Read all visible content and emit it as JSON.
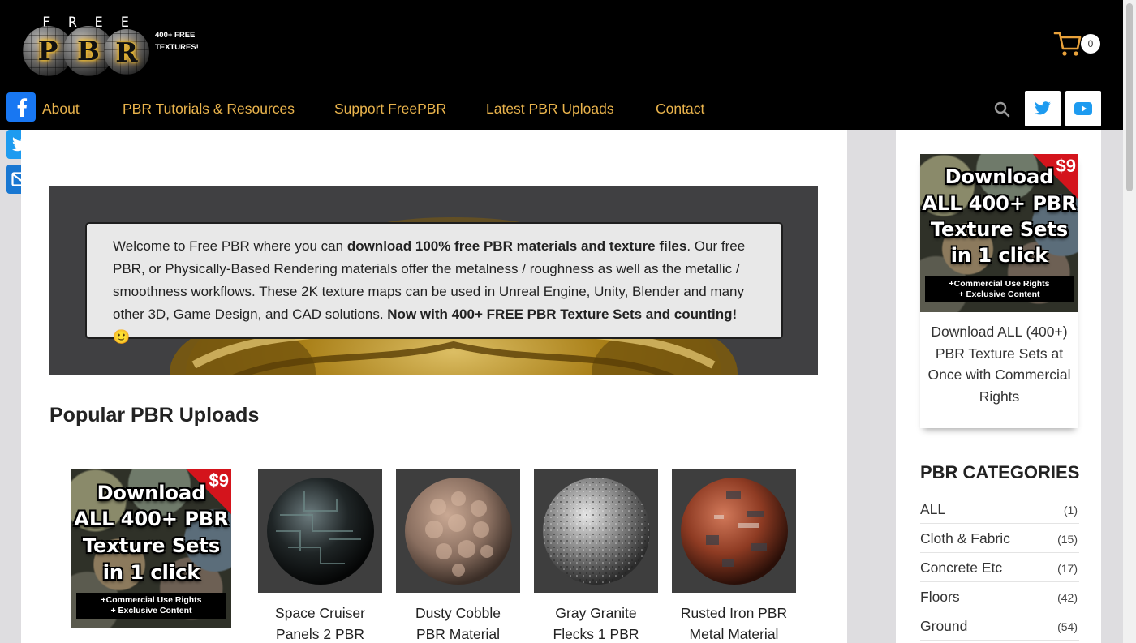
{
  "brand": {
    "logo_top": "FREE",
    "logo_letters": [
      "P",
      "B",
      "R"
    ],
    "tagline_line1": "400+ FREE",
    "tagline_line2": "TEXTURES!",
    "accent": "#e9b34c"
  },
  "cart": {
    "count": "0"
  },
  "nav": {
    "items": [
      {
        "label": "About"
      },
      {
        "label": "PBR Tutorials & Resources"
      },
      {
        "label": "Support FreePBR"
      },
      {
        "label": "Latest PBR Uploads"
      },
      {
        "label": "Contact"
      }
    ]
  },
  "icons": {
    "search": "search-icon",
    "twitter": "twitter-icon",
    "youtube": "youtube-icon",
    "facebook": "facebook-icon",
    "email": "email-icon",
    "cart": "cart-icon"
  },
  "welcome": {
    "p1": "Welcome to Free PBR where you can ",
    "b1": "download 100% free PBR materials and texture files",
    "p2": ".  Our free PBR, or Physically-Based Rendering materials offer the metalness / roughness as well as the metallic / smoothness workflows.  These 2K texture maps can be used in Unreal Engine, Unity, Blender and many other 3D, Game Design, and CAD solutions. ",
    "b2": "Now with 400+ FREE PBR Texture Sets and counting!",
    "emoji": "🙂"
  },
  "popular": {
    "title": "Popular PBR Uploads",
    "promo": {
      "price": "$9",
      "line1": "Download",
      "line2": "ALL 400+ PBR",
      "line3": "Texture Sets",
      "line4": "in 1 click",
      "rights1": "+Commercial Use Rights",
      "rights2": "+ Exclusive Content"
    },
    "products": [
      {
        "line1": "Space Cruiser",
        "line2": "Panels 2 PBR"
      },
      {
        "line1": "Dusty Cobble",
        "line2": "PBR Material"
      },
      {
        "line1": "Gray Granite",
        "line2": "Flecks 1 PBR"
      },
      {
        "line1": "Rusted Iron PBR",
        "line2": "Metal Material"
      }
    ]
  },
  "sidebar": {
    "promo": {
      "price": "$9",
      "line1": "Download",
      "line2": "ALL 400+ PBR",
      "line3": "Texture Sets",
      "line4": "in 1 click",
      "rights1": "+Commercial Use Rights",
      "rights2": "+ Exclusive Content"
    },
    "caption": "Download ALL (400+) PBR Texture Sets at Once with Commercial Rights",
    "categories_title": "PBR CATEGORIES",
    "categories": [
      {
        "name": "ALL",
        "count": "(1)"
      },
      {
        "name": "Cloth & Fabric",
        "count": "(15)"
      },
      {
        "name": "Concrete Etc",
        "count": "(17)"
      },
      {
        "name": "Floors",
        "count": "(42)"
      },
      {
        "name": "Ground",
        "count": "(54)"
      }
    ]
  }
}
